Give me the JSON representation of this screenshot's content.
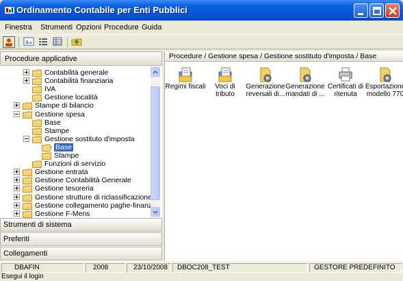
{
  "window": {
    "title": "Ordinamento Contabile per Enti Pubblici",
    "title_icon": "app-logo-icon"
  },
  "menu": [
    "Finestra",
    "Strumenti",
    "Opzioni",
    "Procedure",
    "Guida"
  ],
  "left_pane": {
    "header": "Procedure applicative",
    "tree": [
      {
        "label": "Contabilità generale",
        "level": 1,
        "expander": "plus"
      },
      {
        "label": "Contabilità finanziaria",
        "level": 1,
        "expander": "plus"
      },
      {
        "label": "IVA",
        "level": 1,
        "expander": "none"
      },
      {
        "label": "Gestione località",
        "level": 1,
        "expander": "none"
      },
      {
        "label": "Stampe di bilancio",
        "level": 0,
        "expander": "plus"
      },
      {
        "label": "Gestione spesa",
        "level": 0,
        "expander": "minus"
      },
      {
        "label": "Base",
        "level": 1,
        "expander": "none"
      },
      {
        "label": "Stampe",
        "level": 1,
        "expander": "none"
      },
      {
        "label": "Gestione sostituto d'imposta",
        "level": 1,
        "expander": "minus"
      },
      {
        "label": "Base",
        "level": 2,
        "expander": "none",
        "selected": true,
        "open": true
      },
      {
        "label": "Stampe",
        "level": 2,
        "expander": "none"
      },
      {
        "label": "Funzioni di servizio",
        "level": 1,
        "expander": "none"
      },
      {
        "label": "Gestione entrata",
        "level": 0,
        "expander": "plus"
      },
      {
        "label": "Gestione Contabilità Generale",
        "level": 0,
        "expander": "plus"
      },
      {
        "label": "Gestione tesoreria",
        "level": 0,
        "expander": "plus"
      },
      {
        "label": "Gestione strutture di riclassificazione",
        "level": 0,
        "expander": "plus"
      },
      {
        "label": "Gestione collegamento paghe-finanziaria",
        "level": 0,
        "expander": "plus"
      },
      {
        "label": "Gestione F-Mens",
        "level": 0,
        "expander": "plus"
      }
    ],
    "sections": [
      "Strumenti di sistema",
      "Preferiti",
      "Collegamenti"
    ]
  },
  "right_pane": {
    "breadcrumb": "Procedure / Gestione spesa / Gestione sostituto d'imposta / Base",
    "icons": [
      {
        "label": "Regimi fiscali",
        "icon": "folder-doc-icon"
      },
      {
        "label": "Voci di tributo",
        "icon": "folder-doc-icon"
      },
      {
        "label": "Generazione reversali di...",
        "icon": "gear-doc-icon"
      },
      {
        "label": "Generazione mandati di ...",
        "icon": "gear-doc-icon"
      },
      {
        "label": "Certificati di ritenuta",
        "icon": "printer-icon"
      },
      {
        "label": "Esportazione modello 770",
        "icon": "gear-doc-icon"
      }
    ]
  },
  "status": {
    "user": "DBAFIN",
    "year": "2008",
    "date": "23/10/2008",
    "db": "DBOC208_TEST",
    "profile": "GESTORE PREDEFINITO"
  },
  "message": "Esegui il login",
  "colors": {
    "titlebar": "#0554d8",
    "selection": "#316ac5",
    "chrome": "#ece9d8"
  }
}
